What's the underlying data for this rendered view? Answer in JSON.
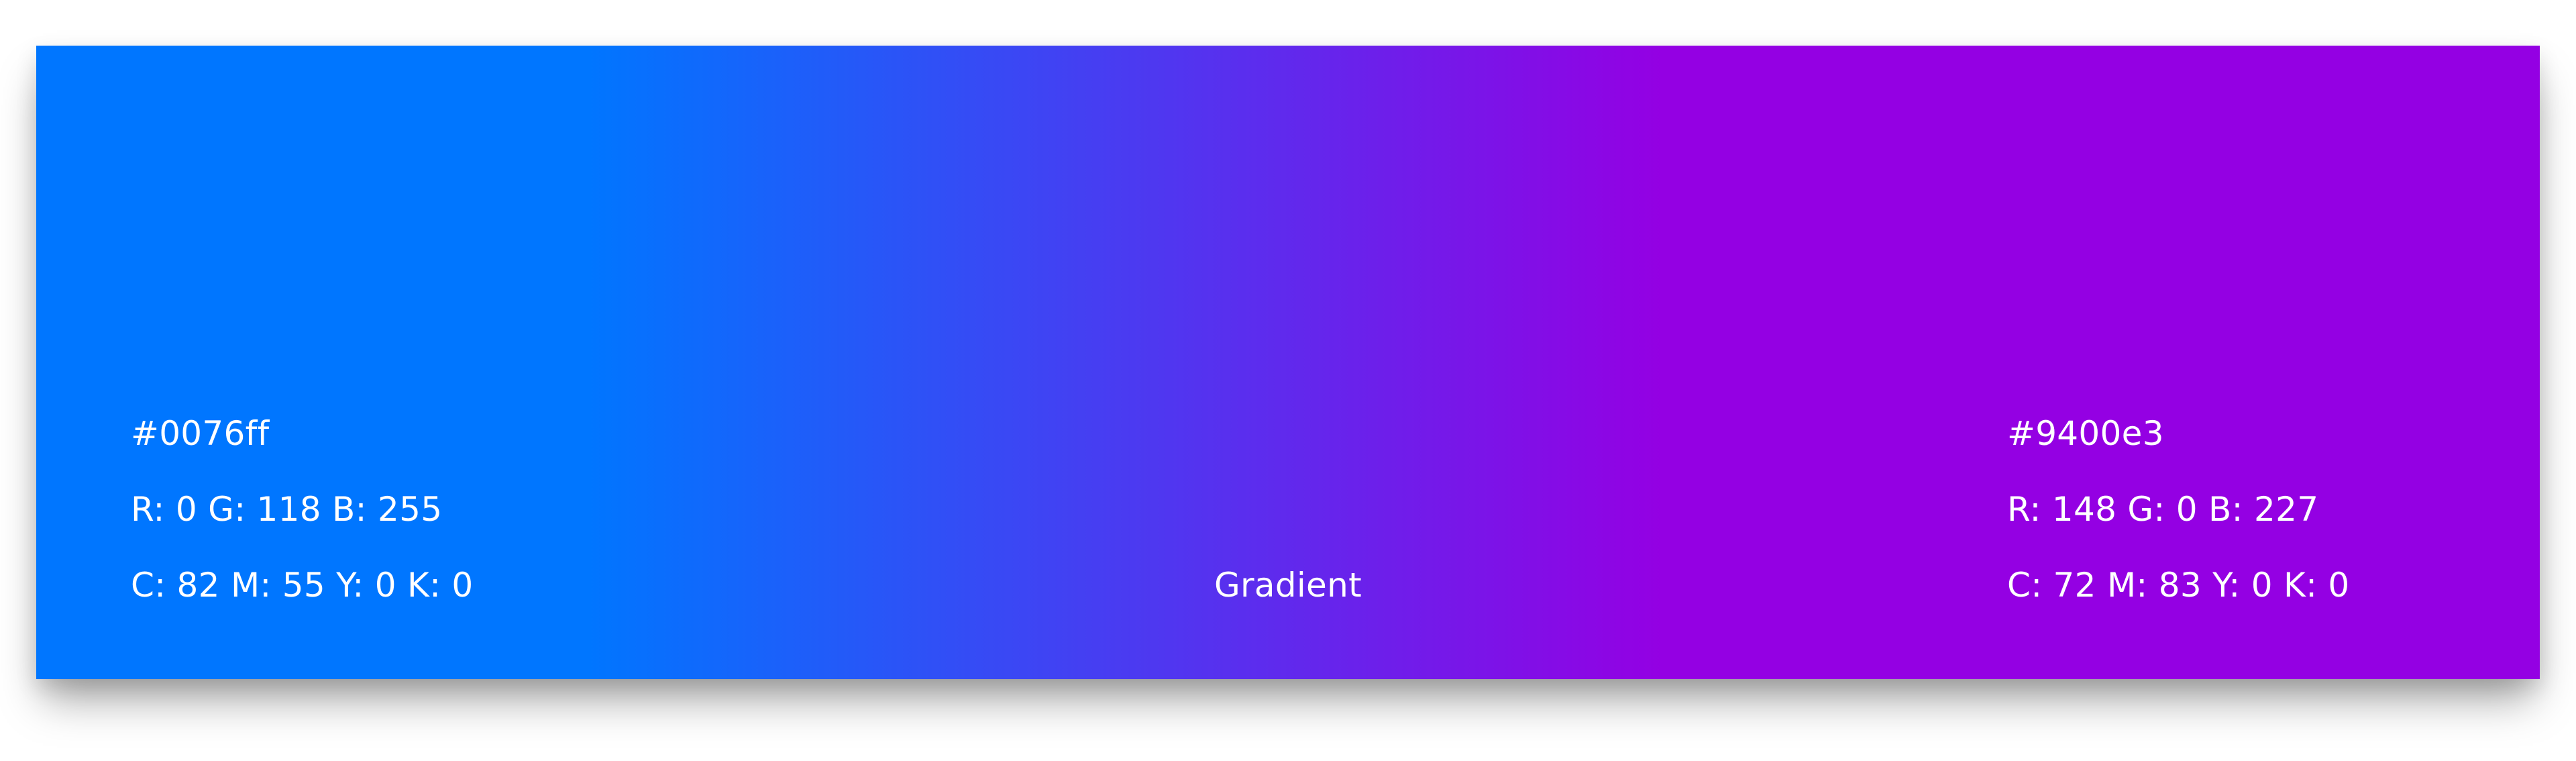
{
  "gradient": {
    "label": "Gradient",
    "start": {
      "hex": "#0076ff",
      "rgb": "R: 0 G: 118 B: 255",
      "cmyk": "C: 82 M: 55 Y: 0 K: 0",
      "color": "#0076ff"
    },
    "end": {
      "hex": "#9400e3",
      "rgb": "R: 148 G: 0 B: 227",
      "cmyk": "C: 72 M: 83 Y: 0 K: 0",
      "color": "#9400e3"
    }
  }
}
